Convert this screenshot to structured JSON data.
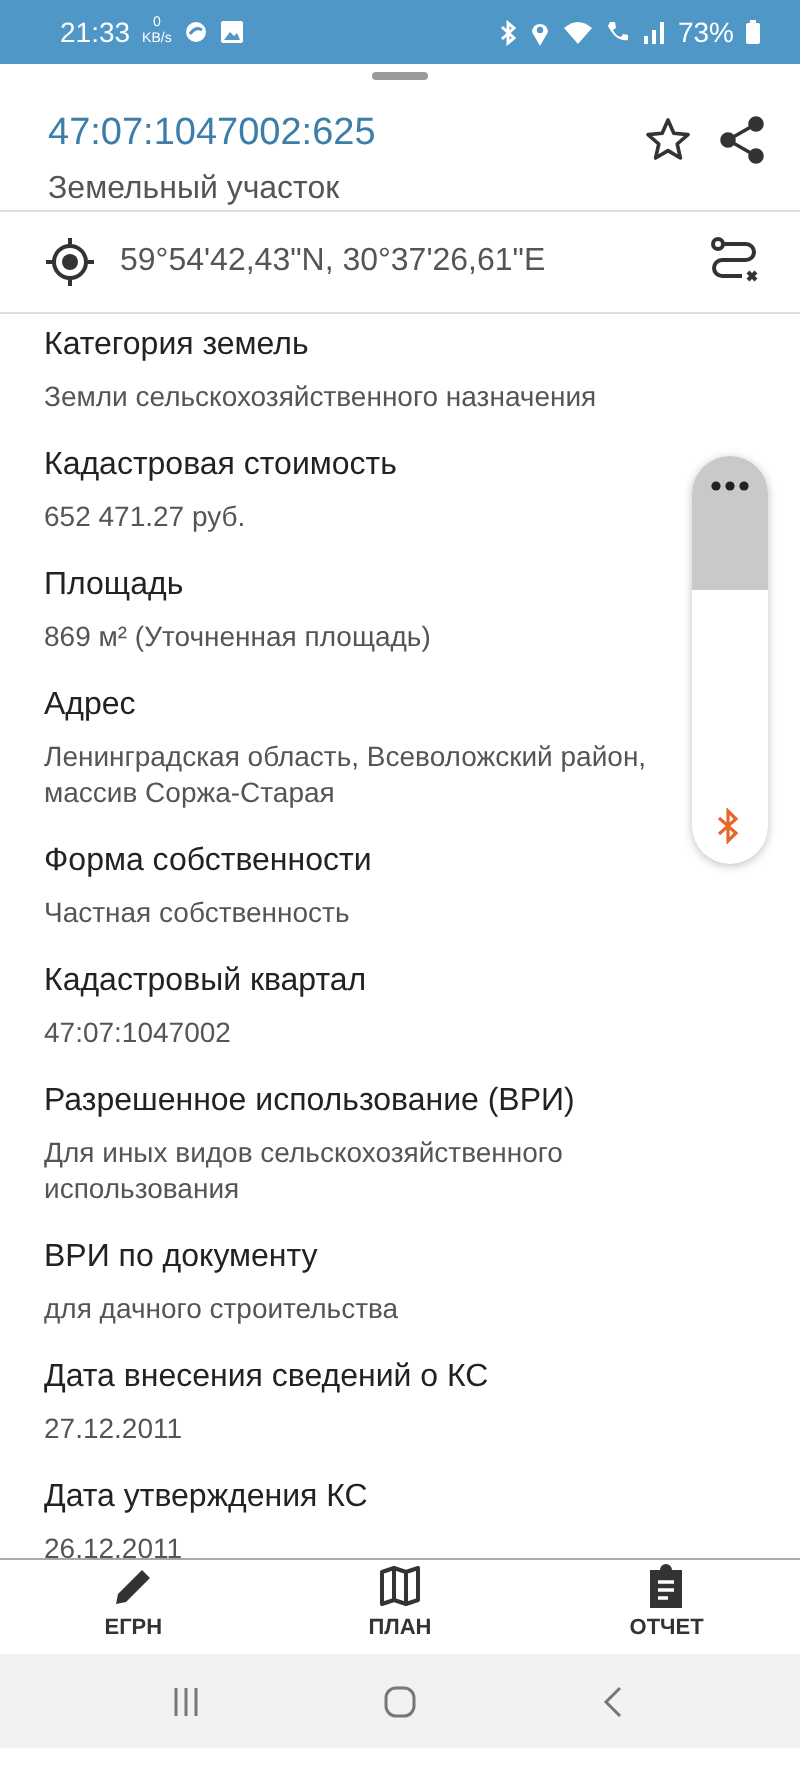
{
  "status_bar": {
    "time": "21:33",
    "net_speed": "0",
    "net_unit": "KB/s",
    "battery": "73%"
  },
  "header": {
    "title": "47:07:1047002:625",
    "subtitle": "Земельный участок",
    "favorite": false
  },
  "coordinates": "59°54'42,43\"N, 30°37'26,61\"E",
  "fields": [
    {
      "label": "Категория земель",
      "value": "Земли сельскохозяйственного назначения"
    },
    {
      "label": "Кадастровая стоимость",
      "value": "652 471.27 руб."
    },
    {
      "label": "Площадь",
      "value": "869 м² (Уточненная площадь)"
    },
    {
      "label": "Адрес",
      "value": "Ленинградская область, Всеволожский район, массив Соржа-Старая"
    },
    {
      "label": "Форма собственности",
      "value": "Частная собственность"
    },
    {
      "label": "Кадастровый квартал",
      "value": "47:07:1047002"
    },
    {
      "label": "Разрешенное использование (ВРИ)",
      "value": "Для иных видов сельскохозяйственного использования"
    },
    {
      "label": "ВРИ по документу",
      "value": "для дачного строительства"
    },
    {
      "label": "Дата внесения сведений о КС",
      "value": "27.12.2011"
    },
    {
      "label": "Дата утверждения КС",
      "value": "26.12.2011"
    }
  ],
  "bottom_nav": [
    {
      "kind": "pencil",
      "label": "ЕГРН"
    },
    {
      "kind": "map",
      "label": "ПЛАН"
    },
    {
      "kind": "report",
      "label": "ОТЧЕТ"
    }
  ]
}
